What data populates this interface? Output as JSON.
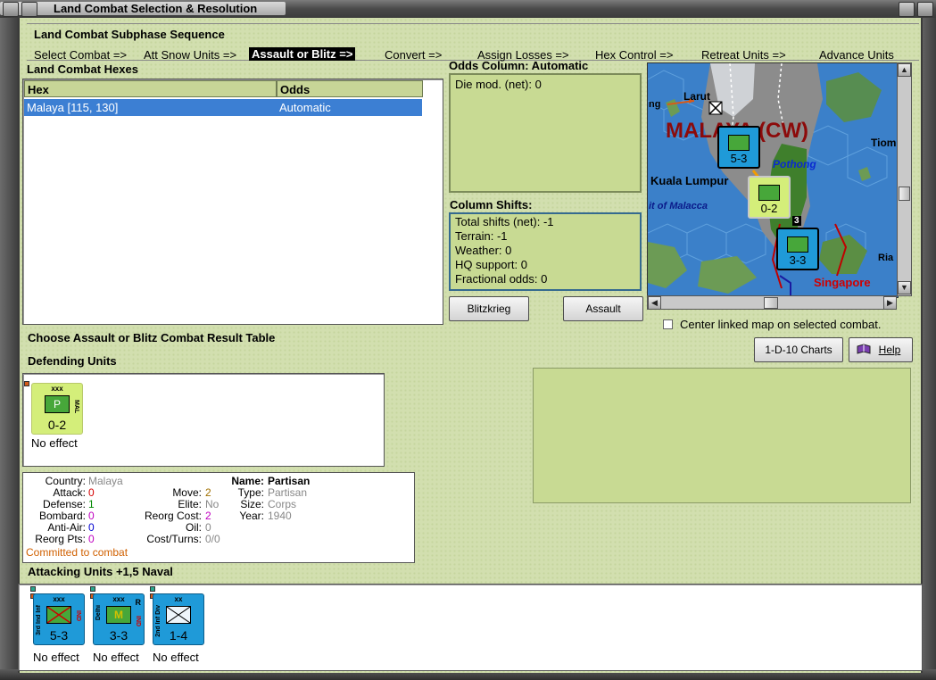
{
  "window": {
    "title": "Land Combat Selection & Resolution"
  },
  "sequence": {
    "title": "Land Combat Subphase Sequence",
    "steps": [
      "Select Combat =>",
      "Att Snow Units =>",
      "Assault or Blitz =>",
      "Convert =>",
      "Assign Losses =>",
      "Hex Control =>",
      "Retreat Units =>",
      "Advance Units"
    ],
    "active_index": 2
  },
  "hexes": {
    "title": "Land Combat Hexes",
    "columns": [
      "Hex",
      "Odds"
    ],
    "rows": [
      {
        "hex": "Malaya [115, 130]",
        "odds": "Automatic"
      }
    ]
  },
  "odds": {
    "title": "Odds Column: Automatic",
    "die_mod": "Die mod. (net): 0"
  },
  "shifts": {
    "title": "Column Shifts:",
    "lines": [
      "Total shifts (net): -1",
      "Terrain: -1",
      "Weather: 0",
      "HQ support: 0",
      "Fractional odds: 0"
    ]
  },
  "buttons": {
    "blitzkrieg": "Blitzkrieg",
    "assault": "Assault",
    "charts": "1-D-10 Charts",
    "help": "Help"
  },
  "map": {
    "center_linked_label": "Center linked map on selected combat.",
    "labels": {
      "larut": "Larut",
      "ng": "ng",
      "malaya": "MALAYA (CW)",
      "tiom": "Tiom",
      "pothong": "Pothong",
      "kuala": "Kuala Lumpur",
      "malacca": "it of Malacca",
      "ria": "Ria",
      "singapore": "Singapore",
      "stack": "3"
    }
  },
  "choose_label": "Choose Assault or Blitz Combat Result Table",
  "defending": {
    "title": "Defending Units",
    "units": [
      {
        "size": "xxx",
        "sym": "P",
        "side": "MAL",
        "strength": "0-2",
        "result": "No effect"
      }
    ]
  },
  "unit_info": {
    "country_label": "Country:",
    "country": "Malaya",
    "attack_label": "Attack:",
    "attack": "0",
    "defense_label": "Defense:",
    "defense": "1",
    "bombard_label": "Bombard:",
    "bombard": "0",
    "antiair_label": "Anti-Air:",
    "antiair": "0",
    "reorgpts_label": "Reorg Pts:",
    "reorgpts": "0",
    "move_label": "Move:",
    "move": "2",
    "elite_label": "Elite:",
    "elite": "No",
    "reorgcost_label": "Reorg Cost:",
    "reorgcost": "2",
    "oil_label": "Oil:",
    "oil": "0",
    "costturns_label": "Cost/Turns:",
    "costturns": "0/0",
    "name_label": "Name:",
    "name": "Partisan",
    "type_label": "Type:",
    "type": "Partisan",
    "size_label": "Size:",
    "size": "Corps",
    "year_label": "Year:",
    "year": "1940",
    "status": "Committed to combat"
  },
  "attacking": {
    "title": "Attacking Units +1,5 Naval",
    "units": [
      {
        "size": "xxx",
        "side_l": "3rd Ind Inf",
        "side_r": "IND",
        "strength": "5-3",
        "result": "No effect"
      },
      {
        "size": "xxx",
        "side_l": "Delhi",
        "side_r": "IND",
        "mark": "R",
        "sym": "M",
        "strength": "3-3",
        "result": "No effect"
      },
      {
        "size": "xx",
        "side_l": "2nd Inf Div",
        "strength": "1-4",
        "result": "No effect"
      }
    ]
  },
  "colors": {
    "panel_bg": "#d2dfaf",
    "selection": "#3c7fd3",
    "counter_blue": "#1f9ad8",
    "counter_green": "#d4ee7a",
    "attack_red": "#d40000",
    "defense_green": "#008800",
    "bombard_magenta": "#c000c0",
    "antiair_blue": "#0000d0",
    "status_orange": "#d06000"
  }
}
